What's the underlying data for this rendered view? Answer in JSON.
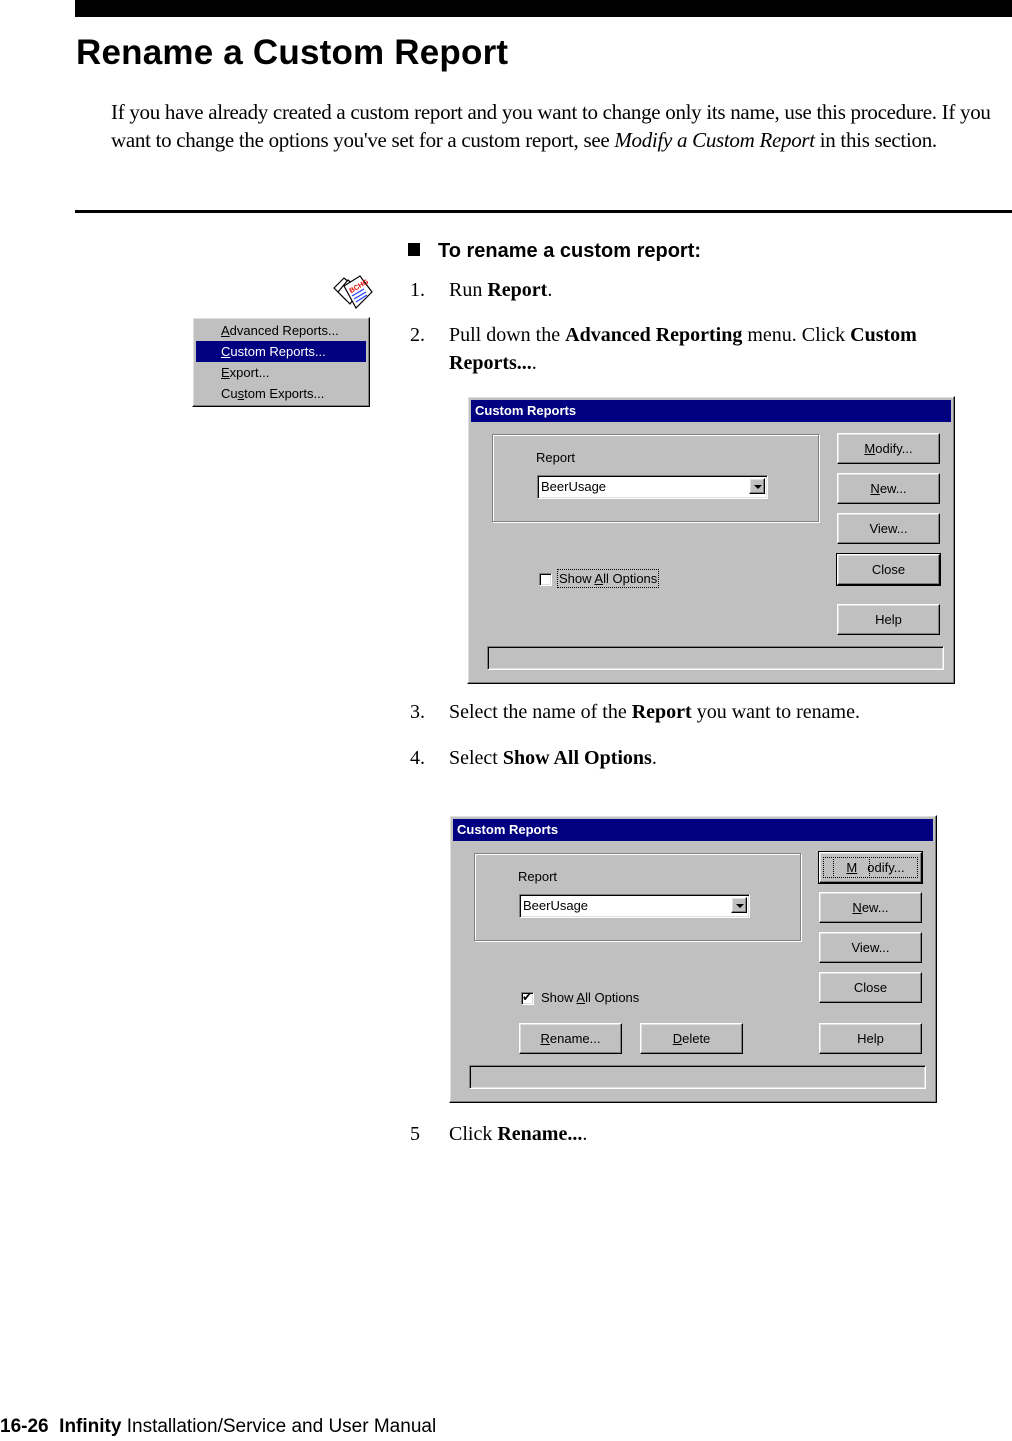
{
  "page": {
    "title": "Rename a Custom Report",
    "intro": {
      "text_before": "If you have already created a custom report and you want to change only its name, use this procedure. If you want to change the options you've set for a custom report, see ",
      "link_italic": "Modify a Custom Report",
      "text_after": " in this section."
    },
    "procedure_heading": "To rename a custom report:",
    "steps": [
      {
        "num": "1.",
        "pre": "Run ",
        "bold": "Report",
        "post": "."
      },
      {
        "num": "2.",
        "pre": "Pull down the ",
        "bold": "Advanced Reporting",
        "mid": " menu. Click ",
        "bold2": "Custom Reports...",
        "post": "."
      },
      {
        "num": "3.",
        "pre": "Select the name of the ",
        "bold": "Report",
        "post": " you want to rename."
      },
      {
        "num": "4.",
        "pre": "Select ",
        "bold": "Show All Options",
        "post": "."
      },
      {
        "num": "5",
        "pre": "Click ",
        "bold": "Rename...",
        "post": "."
      }
    ],
    "footer": {
      "page_number": "16-26",
      "product": "Infinity",
      "manual": "Installation/Service and User Manual"
    }
  },
  "menu": {
    "icon": "report-icon",
    "items": [
      {
        "label": "Advanced Reports...",
        "mnemonic": "A",
        "selected": false
      },
      {
        "label": "Custom Reports...",
        "mnemonic": "C",
        "selected": true
      },
      {
        "label": "Export...",
        "mnemonic": "E",
        "selected": false
      },
      {
        "label": "Custom Exports...",
        "mnemonic": "s",
        "selected": false
      }
    ]
  },
  "dialog1": {
    "title": "Custom Reports",
    "report_label": "Report",
    "report_value": "BeerUsage",
    "show_all_options": {
      "label": "Show All Options",
      "checked": false
    },
    "buttons": {
      "modify": "Modify...",
      "new": "New...",
      "view": "View...",
      "close": "Close",
      "help": "Help"
    },
    "status": ""
  },
  "dialog2": {
    "title": "Custom Reports",
    "report_label": "Report",
    "report_value": "BeerUsage",
    "show_all_options": {
      "label": "Show All Options",
      "checked": true
    },
    "buttons": {
      "modify": "Modify...",
      "new": "New...",
      "view": "View...",
      "close": "Close",
      "help": "Help",
      "rename": "Rename...",
      "delete": "Delete"
    },
    "status": ""
  },
  "colors": {
    "titlebar": "#000080",
    "face": "#c0c0c0",
    "selection": "#000080"
  }
}
